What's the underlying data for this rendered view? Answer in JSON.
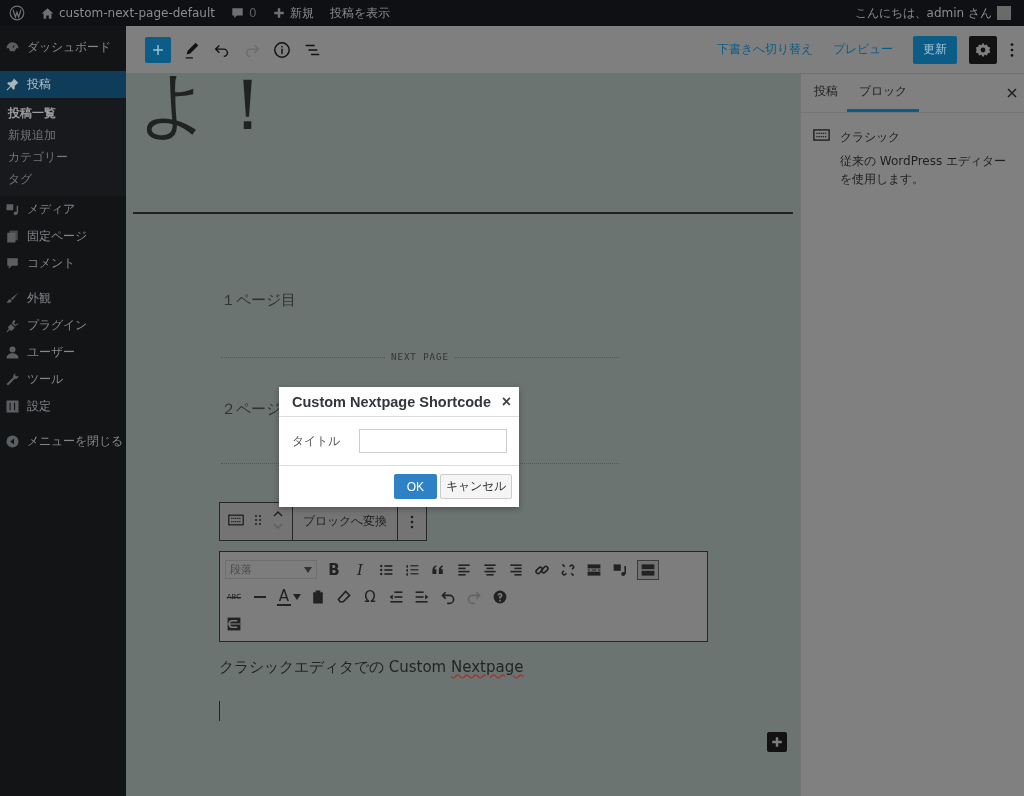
{
  "admin_bar": {
    "site_name": "custom-next-page-default",
    "comments": "0",
    "new": "新規",
    "view_post": "投稿を表示",
    "greeting": "こんにちは、admin さん"
  },
  "sidebar": {
    "items": [
      {
        "label": "ダッシュボード",
        "selected": false
      },
      {
        "label": "投稿",
        "selected": true,
        "submenu": [
          {
            "label": "投稿一覧",
            "selected": true
          },
          {
            "label": "新規追加",
            "selected": false
          },
          {
            "label": "カテゴリー",
            "selected": false
          },
          {
            "label": "タグ",
            "selected": false
          }
        ]
      },
      {
        "label": "メディア",
        "selected": false
      },
      {
        "label": "固定ページ",
        "selected": false
      },
      {
        "label": "コメント",
        "selected": false
      },
      {
        "label": "外観",
        "selected": false
      },
      {
        "label": "プラグイン",
        "selected": false
      },
      {
        "label": "ユーザー",
        "selected": false
      },
      {
        "label": "ツール",
        "selected": false
      },
      {
        "label": "設定",
        "selected": false
      },
      {
        "label": "メニューを閉じる",
        "selected": false
      }
    ]
  },
  "editor_header": {
    "redo_disabled": true,
    "switch_to_draft": "下書きへ切り替え",
    "preview": "プレビュー",
    "update": "更新"
  },
  "settings_panel": {
    "tabs": [
      {
        "label": "投稿",
        "selected": false
      },
      {
        "label": "ブロック",
        "selected": true
      }
    ],
    "block_name": "クラシック",
    "block_description": "従来の WordPress エディターを使用します。"
  },
  "content": {
    "heading_fragment": "よ！",
    "paragraph_1": "１ページ目",
    "divider_label": "NEXT PAGE",
    "paragraph_2": "２ページ",
    "transform": "ブロックへ変換",
    "classic": {
      "format": "段落",
      "toolbar_rows": [
        [
          {
            "kind": "bold",
            "glyph": "B",
            "disabled": false,
            "pressed": false
          },
          {
            "kind": "italic",
            "glyph": "I",
            "disabled": false,
            "pressed": false
          },
          {
            "kind": "bullets",
            "disabled": false,
            "pressed": false
          },
          {
            "kind": "numbers",
            "disabled": false,
            "pressed": false
          },
          {
            "kind": "quote",
            "disabled": false,
            "pressed": false
          },
          {
            "kind": "align-left",
            "disabled": false,
            "pressed": false
          },
          {
            "kind": "align-center",
            "disabled": false,
            "pressed": false
          },
          {
            "kind": "align-right",
            "disabled": false,
            "pressed": false
          },
          {
            "kind": "link",
            "disabled": false,
            "pressed": false
          },
          {
            "kind": "unlink",
            "disabled": false,
            "pressed": false
          },
          {
            "kind": "more",
            "disabled": false,
            "pressed": false
          },
          {
            "kind": "media",
            "disabled": false,
            "pressed": false
          },
          {
            "kind": "toolbar-toggle",
            "disabled": false,
            "pressed": true
          }
        ],
        [
          {
            "kind": "strike",
            "glyph": "ABC",
            "disabled": false,
            "pressed": false
          },
          {
            "kind": "hr",
            "disabled": false,
            "pressed": false
          },
          {
            "kind": "text-color",
            "glyph": "A",
            "disabled": false,
            "pressed": false
          },
          {
            "kind": "paste",
            "disabled": false,
            "pressed": false
          },
          {
            "kind": "eraser",
            "disabled": false,
            "pressed": false
          },
          {
            "kind": "omega",
            "glyph": "Ω",
            "disabled": false,
            "pressed": false
          },
          {
            "kind": "outdent",
            "disabled": false,
            "pressed": false
          },
          {
            "kind": "indent",
            "disabled": false,
            "pressed": false
          },
          {
            "kind": "undo",
            "disabled": false,
            "pressed": false
          },
          {
            "kind": "redo",
            "disabled": true,
            "pressed": false
          },
          {
            "kind": "help",
            "disabled": false,
            "pressed": false
          }
        ],
        [
          {
            "kind": "nextpage",
            "disabled": false,
            "pressed": false
          }
        ]
      ],
      "text_start": "クラシックエディタでの Custom ",
      "text_misspelled": "Nextpage"
    }
  },
  "dialog": {
    "title": "Custom Nextpage Shortcode",
    "close": "×",
    "field_label": "タイトル",
    "ok": "OK",
    "cancel": "キャンセル"
  }
}
